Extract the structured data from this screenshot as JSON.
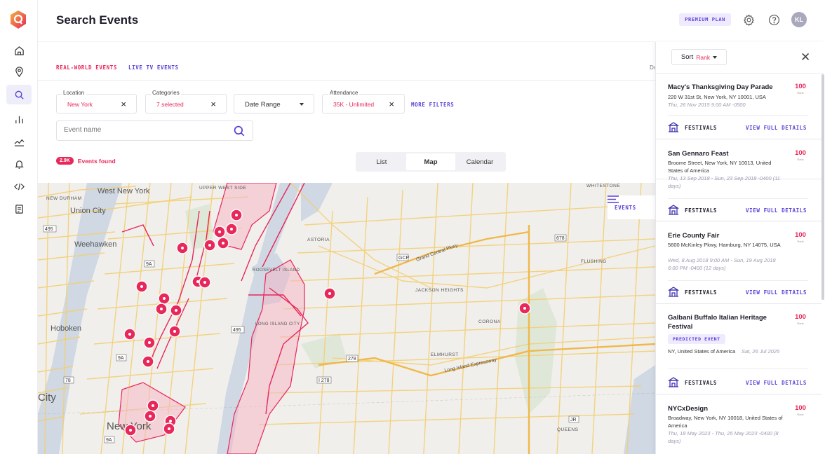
{
  "app": {
    "title": "Search Events",
    "premium_label": "PREMIUM PLAN",
    "user_initials": "KL",
    "partial_text": "Do"
  },
  "nav": [
    {
      "name": "home-icon"
    },
    {
      "name": "location-icon"
    },
    {
      "name": "search-icon",
      "active": true
    },
    {
      "name": "chart-icon"
    },
    {
      "name": "trend-icon"
    },
    {
      "name": "bell-icon"
    },
    {
      "name": "code-icon"
    },
    {
      "name": "document-icon"
    }
  ],
  "tabs": [
    {
      "label": "REAL-WORLD EVENTS",
      "active": true
    },
    {
      "label": "LIVE TV EVENTS",
      "active": false
    }
  ],
  "filters": {
    "location": {
      "label": "Location",
      "value": "New York"
    },
    "categories": {
      "label": "Categories",
      "value": "7 selected"
    },
    "date_range": {
      "value": "Date Range"
    },
    "attendance": {
      "label": "Attendance",
      "value": "35K - Unlimited"
    },
    "more_label": "MORE FILTERS"
  },
  "search": {
    "placeholder": "Event name"
  },
  "results": {
    "count": "2.9K",
    "label": "Events found"
  },
  "view_toggle": {
    "options": [
      "List",
      "Map",
      "Calendar"
    ],
    "selected": "Map"
  },
  "map": {
    "events_button": "EVENTS",
    "labels": [
      "West New York",
      "UPPER WEST SIDE",
      "NEW DURHAM",
      "Union City",
      "Weehawken",
      "Hoboken",
      "City",
      "New York",
      "ASTORIA",
      "ROOSEVELT ISLAND",
      "JACKSON HEIGHTS",
      "LONG ISLAND CITY",
      "CORONA",
      "ELMHURST",
      "FLUSHING",
      "QUEENS",
      "WHITESTONE",
      "Grand Central Pkwy",
      "Long Island Expressway"
    ],
    "shields": [
      "495",
      "9A",
      "495",
      "9A",
      "78",
      "9A",
      "278",
      "I 278",
      "678",
      "GCP",
      "JR"
    ]
  },
  "panel": {
    "sort_label": "Sort",
    "sort_value": "Rank",
    "view_details_label": "VIEW FULL DETAILS",
    "rank_label": "Rank",
    "events": [
      {
        "title": "Macy's Thanksgiving Day Parade",
        "address": "220 W 31st St, New York, NY 10001, USA",
        "date": "Thu, 26 Nov 2015 9:00 AM -0500",
        "rank": "100",
        "category": "FESTIVALS"
      },
      {
        "title": "San Gennaro Feast",
        "address": "Broome Street, New York, NY 10013, United States of America",
        "date": "Thu, 13 Sep 2018 - Sun, 23 Sep 2018 -0400 (11 days)",
        "rank": "100",
        "category": "FESTIVALS"
      },
      {
        "title": "Erie County Fair",
        "address": "5600 McKinley Pkwy, Hamburg, NY 14075, USA",
        "date": "Wed, 8 Aug 2018 9:00 AM - Sun, 19 Aug 2018 6:00 PM -0400 (12 days)",
        "rank": "100",
        "category": "FESTIVALS"
      },
      {
        "title": "Galbani Buffalo Italian Heritage Festival",
        "badge": "PREDICTED EVENT",
        "address": "NY, United States of America",
        "date": "Sat, 26 Jul 2025",
        "rank": "100",
        "category": "FESTIVALS"
      },
      {
        "title": "NYCxDesign",
        "address": "Broadway, New York, NY 10018, United States of America",
        "date": "Thu, 18 May 2023 - Thu, 25 May 2023 -0400 (8 days)",
        "rank": "100"
      }
    ]
  },
  "colors": {
    "accent": "#e8275a",
    "brand": "#5b3fd6",
    "logo": "#f05537"
  }
}
